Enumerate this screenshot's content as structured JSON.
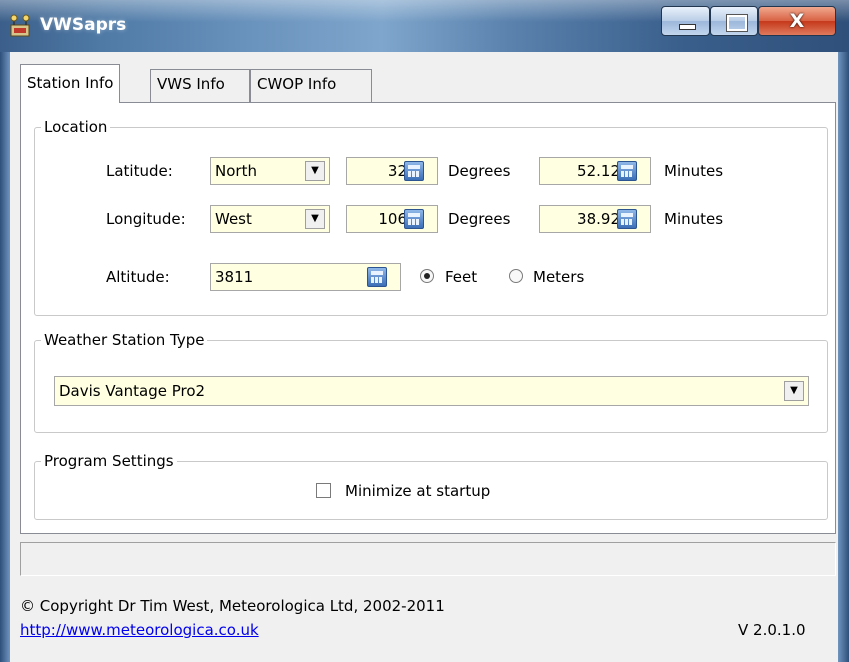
{
  "window": {
    "title": "VWSaprs",
    "close_glyph": "X",
    "icons": {
      "app": "weather-station-icon",
      "minimize": "minimize-icon",
      "maximize": "maximize-icon",
      "close": "close-icon"
    }
  },
  "tabs": [
    {
      "label": "Station Info",
      "active": true
    },
    {
      "label": "VWS Info",
      "active": false
    },
    {
      "label": "CWOP Info",
      "active": false
    }
  ],
  "location": {
    "legend": "Location",
    "latitude": {
      "label": "Latitude:",
      "hemisphere": "North",
      "degrees": "32",
      "degrees_unit": "Degrees",
      "minutes": "52.12",
      "minutes_unit": "Minutes"
    },
    "longitude": {
      "label": "Longitude:",
      "hemisphere": "West",
      "degrees": "106",
      "degrees_unit": "Degrees",
      "minutes": "38.92",
      "minutes_unit": "Minutes"
    },
    "altitude": {
      "label": "Altitude:",
      "value": "3811",
      "unit_feet": "Feet",
      "unit_meters": "Meters",
      "selected_unit": "Feet"
    }
  },
  "station_type": {
    "legend": "Weather Station Type",
    "selected": "Davis Vantage Pro2"
  },
  "program_settings": {
    "legend": "Program Settings",
    "minimize_label": "Minimize at startup",
    "minimize_checked": false
  },
  "status_text": "",
  "footer": {
    "copyright": "© Copyright Dr Tim West, Meteorologica Ltd, 2002-2011",
    "link": "http://www.meteorologica.co.uk",
    "version": "V 2.0.1.0"
  },
  "colors": {
    "field_bg": "#ffffe1",
    "dialog_bg": "#f0f0f0",
    "link": "#0000ee",
    "close_button": "#c5381a"
  }
}
